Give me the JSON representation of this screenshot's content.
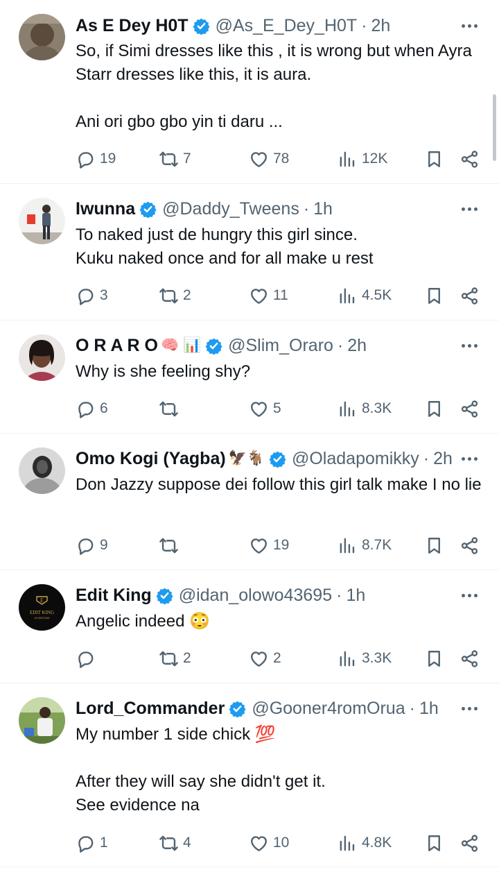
{
  "tweets": [
    {
      "name": "As E Dey H0T",
      "handle": "@As_E_Dey_H0T",
      "dot": "·",
      "time": "2h",
      "text": [
        "So, if Simi dresses like this , it is wrong but when Ayra Starr dresses like this, it is aura.",
        "",
        "Ani ori gbo gbo yin ti daru ..."
      ],
      "replies": "19",
      "reposts": "7",
      "likes": "78",
      "views": "12K"
    },
    {
      "name": "Iwunna",
      "handle": "@Daddy_Tweens",
      "dot": "·",
      "time": "1h",
      "text": [
        "To naked just de hungry this girl since.",
        "Kuku naked once and for all make u rest"
      ],
      "replies": "3",
      "reposts": "2",
      "likes": "11",
      "views": "4.5K"
    },
    {
      "name": "O R A R O",
      "name_emojis": "🧠 📊",
      "handle": "@Slim_Oraro",
      "dot": "·",
      "time": "2h",
      "text": [
        "Why is she feeling shy?"
      ],
      "replies": "6",
      "reposts": "",
      "likes": "5",
      "views": "8.3K"
    },
    {
      "name": "Omo Kogi (Yagba)",
      "name_emojis": "🦅🐐",
      "handle": "@Oladapomikky",
      "dot": "·",
      "time": "2h",
      "text": [
        "Don Jazzy suppose dei follow this girl talk make I no lie"
      ],
      "replies": "9",
      "reposts": "",
      "likes": "19",
      "views": "8.7K"
    },
    {
      "name": "Edit King",
      "handle": "@idan_olowo43695",
      "dot": "·",
      "time": "1h",
      "text": [
        "Angelic indeed 😳"
      ],
      "replies": "",
      "reposts": "2",
      "likes": "2",
      "views": "3.3K",
      "avatar_text": "EDIT KING",
      "avatar_subtext": "OLOWO IDAN",
      "avatar_letter": "E"
    },
    {
      "name": "Lord_Commander",
      "handle": "@Gooner4romOrua",
      "dot": "·",
      "time": "1h",
      "text": [
        "My number 1 side chick 💯",
        "",
        "After they will say she didn't get it.",
        "See evidence na"
      ],
      "replies": "1",
      "reposts": "4",
      "likes": "10",
      "views": "4.8K"
    }
  ],
  "icons": {
    "verified": "verified-badge-icon",
    "more": "more-options-icon",
    "reply": "reply-icon",
    "repost": "repost-icon",
    "like": "like-icon",
    "views": "views-icon",
    "bookmark": "bookmark-icon",
    "share": "share-icon"
  },
  "colors": {
    "verified": "#1d9bf0",
    "muted": "#536471",
    "text": "#0f1419",
    "divider": "#eff3f4"
  }
}
